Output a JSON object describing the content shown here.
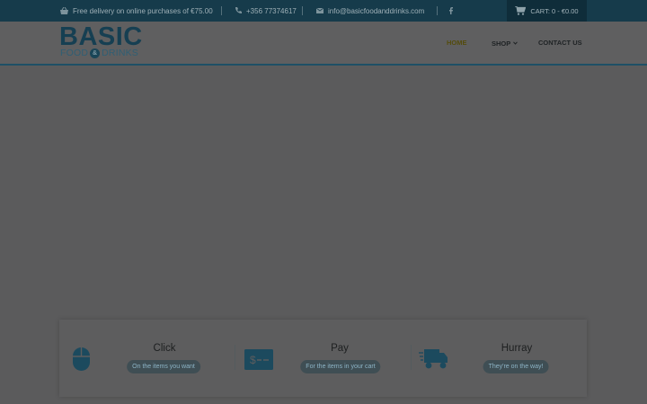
{
  "topbar": {
    "delivery_text": "Free delivery on online purchases of €75.00",
    "phone": "+356 77374617",
    "email": "info@basicfoodanddrinks.com",
    "social_icon": "facebook-icon",
    "cart_label": "CART: 0 - €0.00"
  },
  "logo": {
    "word": "BASIC",
    "sub_left": "FOOD",
    "sub_and": "&",
    "sub_right": "DRINKS"
  },
  "nav": {
    "home": "HOME",
    "shop": "SHOP",
    "contact": "CONTACT US"
  },
  "steps": [
    {
      "icon": "mouse-icon",
      "title": "Click",
      "caption": "On the items you want"
    },
    {
      "icon": "cheque-icon",
      "title": "Pay",
      "caption": "For the items in your cart"
    },
    {
      "icon": "delivery-truck-icon",
      "title": "Hurray",
      "caption": "They're on the way!"
    }
  ],
  "colors": {
    "topbar": "#163b4b",
    "cart_bg": "#0f2d3a",
    "accent": "#1e5066",
    "overlay": "#5b5b5c"
  }
}
